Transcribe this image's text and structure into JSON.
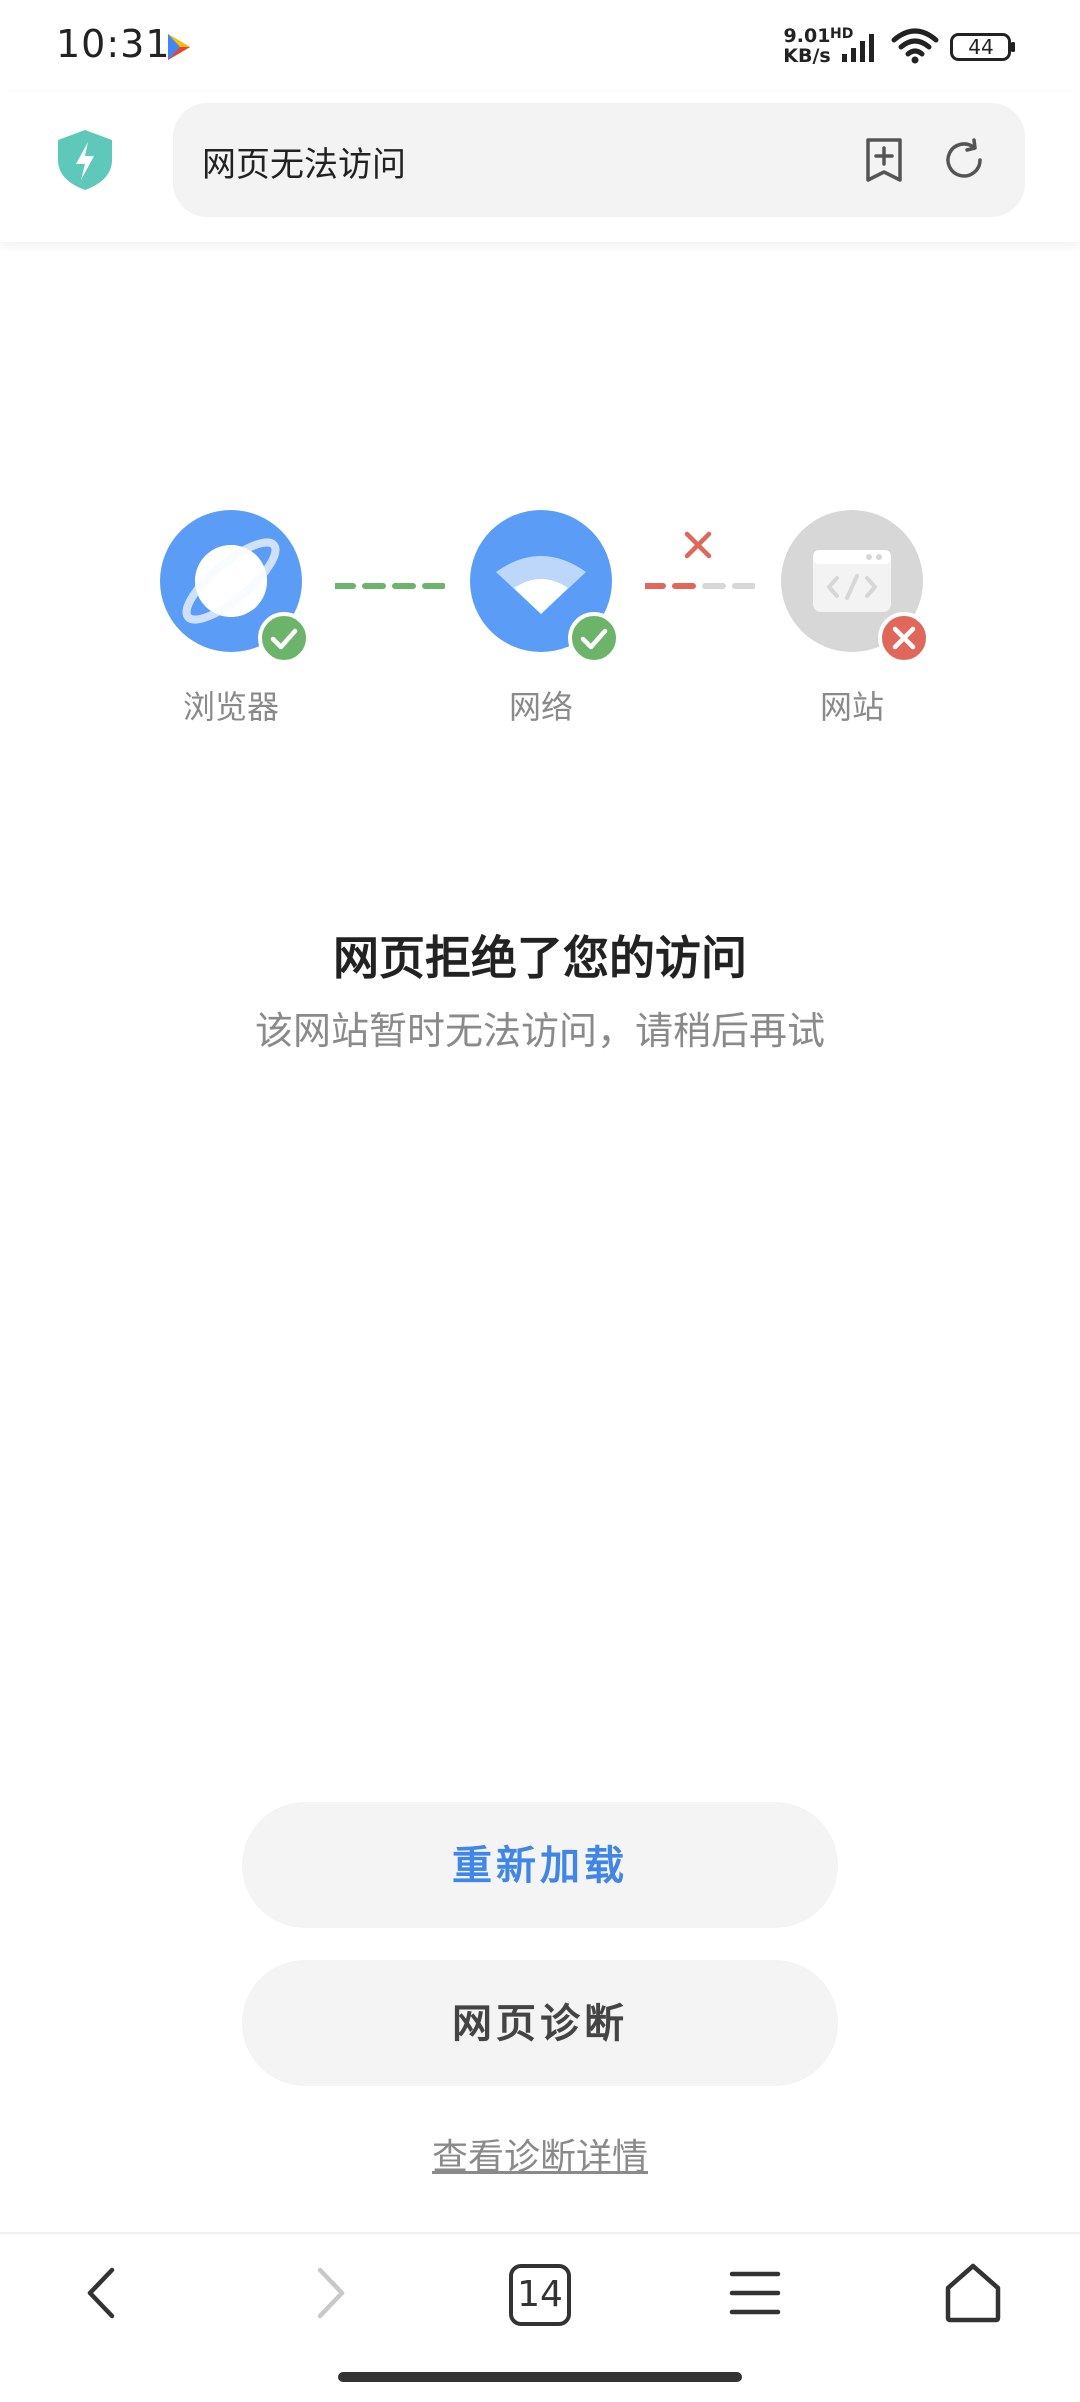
{
  "status_bar": {
    "time": "10:31",
    "net_speed_value": "9.01",
    "net_speed_unit": "KB/s",
    "hd_label": "HD",
    "battery_level": "44",
    "icons": [
      "play-store-icon",
      "signal-icon",
      "wifi-icon",
      "battery-icon"
    ]
  },
  "header": {
    "page_title": "网页无法访问",
    "icons": [
      "shield-icon",
      "bookmark-add-icon",
      "reload-icon"
    ]
  },
  "diagram": {
    "nodes": [
      {
        "label": "浏览器",
        "status": "ok"
      },
      {
        "label": "网络",
        "status": "ok"
      },
      {
        "label": "网站",
        "status": "fail"
      }
    ]
  },
  "message": {
    "title": "网页拒绝了您的访问",
    "subtitle": "该网站暂时无法访问，请稍后再试"
  },
  "actions": {
    "reload_label": "重新加载",
    "diagnose_label": "网页诊断",
    "details_link": "查看诊断详情"
  },
  "bottom_nav": {
    "tabs_count": "14",
    "icons": [
      "back-icon",
      "forward-icon",
      "tabs-icon",
      "menu-icon",
      "home-icon"
    ]
  },
  "colors": {
    "accent_blue": "#3f86e8",
    "node_blue": "#5b9cf6",
    "ok_green": "#6cb46a",
    "fail_red": "#e0685a",
    "node_gray": "#d7d7d7"
  }
}
